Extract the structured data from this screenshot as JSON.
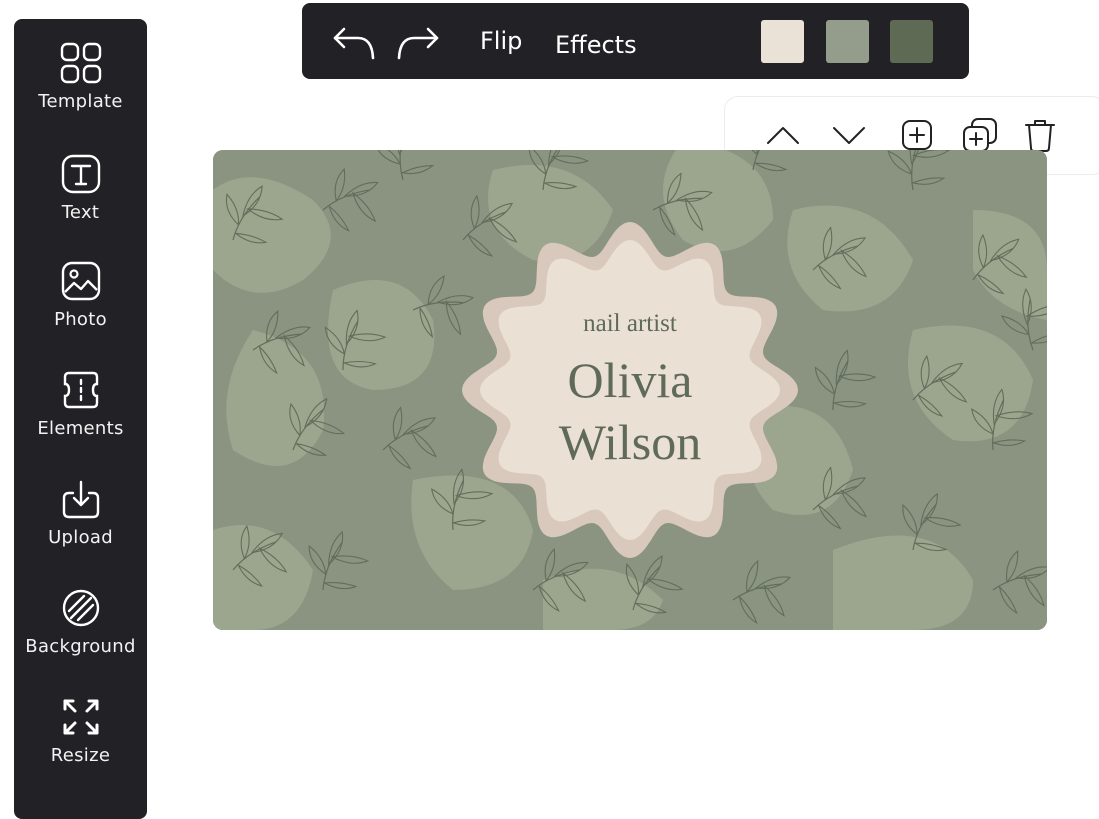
{
  "sidebar": {
    "items": [
      {
        "label": "Template",
        "icon": "template-grid-icon"
      },
      {
        "label": "Text",
        "icon": "text-icon"
      },
      {
        "label": "Photo",
        "icon": "photo-icon"
      },
      {
        "label": "Elements",
        "icon": "elements-icon"
      },
      {
        "label": "Upload",
        "icon": "upload-icon"
      },
      {
        "label": "Background",
        "icon": "background-icon"
      },
      {
        "label": "Resize",
        "icon": "resize-icon"
      }
    ]
  },
  "toolbar": {
    "undo_icon": "undo-icon",
    "redo_icon": "redo-icon",
    "flip_label": "Flip",
    "effects_label": "Effects",
    "swatches": [
      "#ebe2d7",
      "#949d8b",
      "#5e6a53"
    ]
  },
  "layer_panel": {
    "icons": [
      "chevron-up-icon",
      "chevron-down-icon",
      "add-page-icon",
      "duplicate-icon",
      "trash-icon"
    ]
  },
  "card": {
    "subtitle": "nail artist",
    "first_name": "Olivia",
    "last_name": "Wilson"
  },
  "colors": {
    "panel_bg": "#222226",
    "card_bg": "#8a9480",
    "card_blob": "#9ca68f",
    "leaf": "#5f6a58",
    "badge_outer": "#d9c9bc",
    "badge_inner": "#eae0d3",
    "text": "#5f6a58"
  }
}
